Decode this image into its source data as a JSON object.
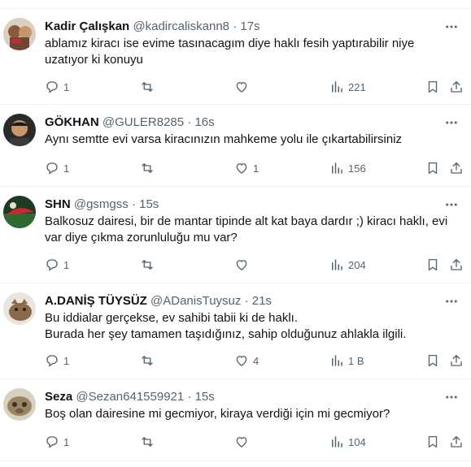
{
  "colors": {
    "text": "#0f1419",
    "muted": "#536471",
    "divider": "#eff3f4"
  },
  "icons": {
    "more": "more-horizontal-icon",
    "reply": "reply-icon",
    "retweet": "retweet-icon",
    "like": "heart-icon",
    "views": "views-bar-chart-icon",
    "bookmark": "bookmark-icon",
    "share": "share-icon"
  },
  "tweets": [
    {
      "name": "Kadir Çalışkan",
      "handle": "@kadircaliskann8",
      "time": "17s",
      "lines": [
        "ablamız kiracı ise evime tasınacagım diye haklı fesih yaptırabilir niye",
        "uzatıyor ki konuyu"
      ],
      "replies": "1",
      "retweets": "",
      "likes": "",
      "views": "221"
    },
    {
      "name": "GÖKHAN",
      "handle": "@GULER8285",
      "time": "16s",
      "lines": [
        "Aynı semtte evi varsa kiracınızın mahkeme yolu ile çıkartabilirsiniz"
      ],
      "replies": "1",
      "retweets": "",
      "likes": "1",
      "views": "156"
    },
    {
      "name": "SHN",
      "handle": "@gsmgss",
      "time": "15s",
      "lines": [
        "Balkosuz dairesi, bir de mantar tipinde alt kat baya dardır ;) kiracı haklı, evi",
        "var diye çıkma zorunluluğu mu var?"
      ],
      "replies": "1",
      "retweets": "",
      "likes": "",
      "views": "204"
    },
    {
      "name": "A.DANİŞ TÜYSÜZ",
      "handle": "@ADanisTuysuz",
      "time": "21s",
      "lines": [
        "Bu iddialar gerçekse, ev sahibi tabii ki de haklı.",
        "Burada her şey tamamen taşıdığınız, sahip olduğunuz ahlakla ilgili."
      ],
      "replies": "1",
      "retweets": "",
      "likes": "4",
      "views": "1 B"
    },
    {
      "name": "Seza",
      "handle": "@Sezan641559921",
      "time": "15s",
      "lines": [
        "Boş olan dairesine mi gecmiyor, kiraya verdiği için mi gecmiyor?"
      ],
      "replies": "1",
      "retweets": "",
      "likes": "",
      "views": "104"
    }
  ]
}
